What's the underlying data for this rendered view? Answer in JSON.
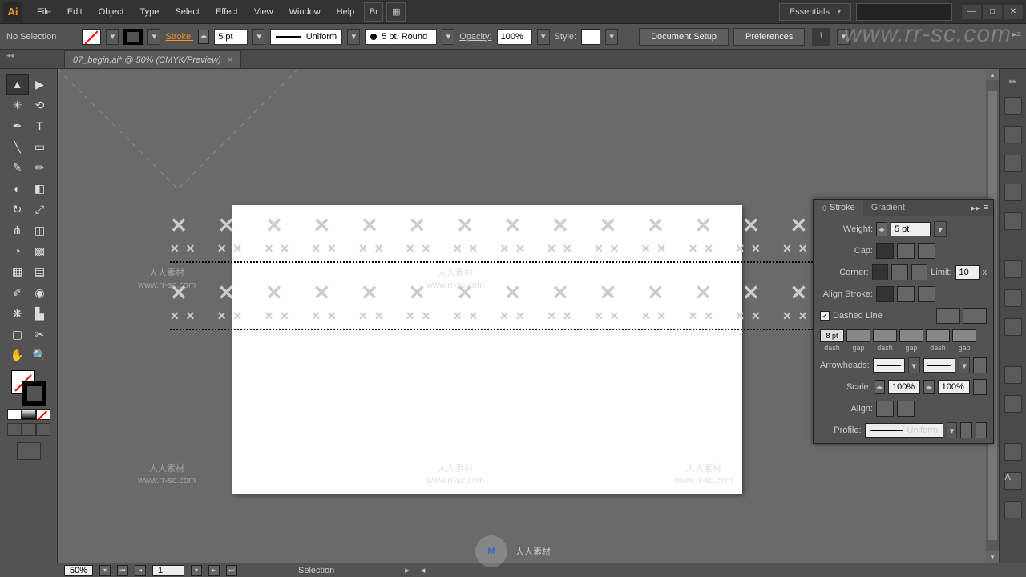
{
  "app": {
    "logo": "Ai",
    "workspace": "Essentials"
  },
  "menu": [
    "File",
    "Edit",
    "Object",
    "Type",
    "Select",
    "Effect",
    "View",
    "Window",
    "Help"
  ],
  "window_controls": {
    "min": "—",
    "max": "□",
    "close": "✕"
  },
  "control": {
    "selection": "No Selection",
    "stroke_label": "Stroke:",
    "stroke_weight": "5 pt",
    "brush": "Uniform",
    "varwidth": "5 pt. Round",
    "opacity_label": "Opacity:",
    "opacity": "100%",
    "style_label": "Style:",
    "doc_setup": "Document Setup",
    "preferences": "Preferences"
  },
  "tab": {
    "title": "07_begin.ai* @ 50% (CMYK/Preview)",
    "close": "×"
  },
  "panel": {
    "tabs": {
      "stroke": "Stroke",
      "gradient": "Gradient"
    },
    "weight_label": "Weight:",
    "weight": "5 pt",
    "cap_label": "Cap:",
    "corner_label": "Corner:",
    "limit_label": "Limit:",
    "limit": "10",
    "limit_unit": "x",
    "align_label": "Align Stroke:",
    "dashed_label": "Dashed Line",
    "dash_val": "8 pt",
    "dash_caps": [
      "dash",
      "gap",
      "dash",
      "gap",
      "dash",
      "gap"
    ],
    "arrow_label": "Arrowheads:",
    "scale_label": "Scale:",
    "scale1": "100%",
    "scale2": "100%",
    "align_arrow_label": "Align:",
    "profile_label": "Profile:",
    "profile": "Uniform"
  },
  "status": {
    "zoom": "50%",
    "page": "1",
    "tool": "Selection"
  },
  "watermark": {
    "url": "www.rr-sc.com",
    "cn": "人人素材",
    "sub": "www.rr-sc.com"
  }
}
